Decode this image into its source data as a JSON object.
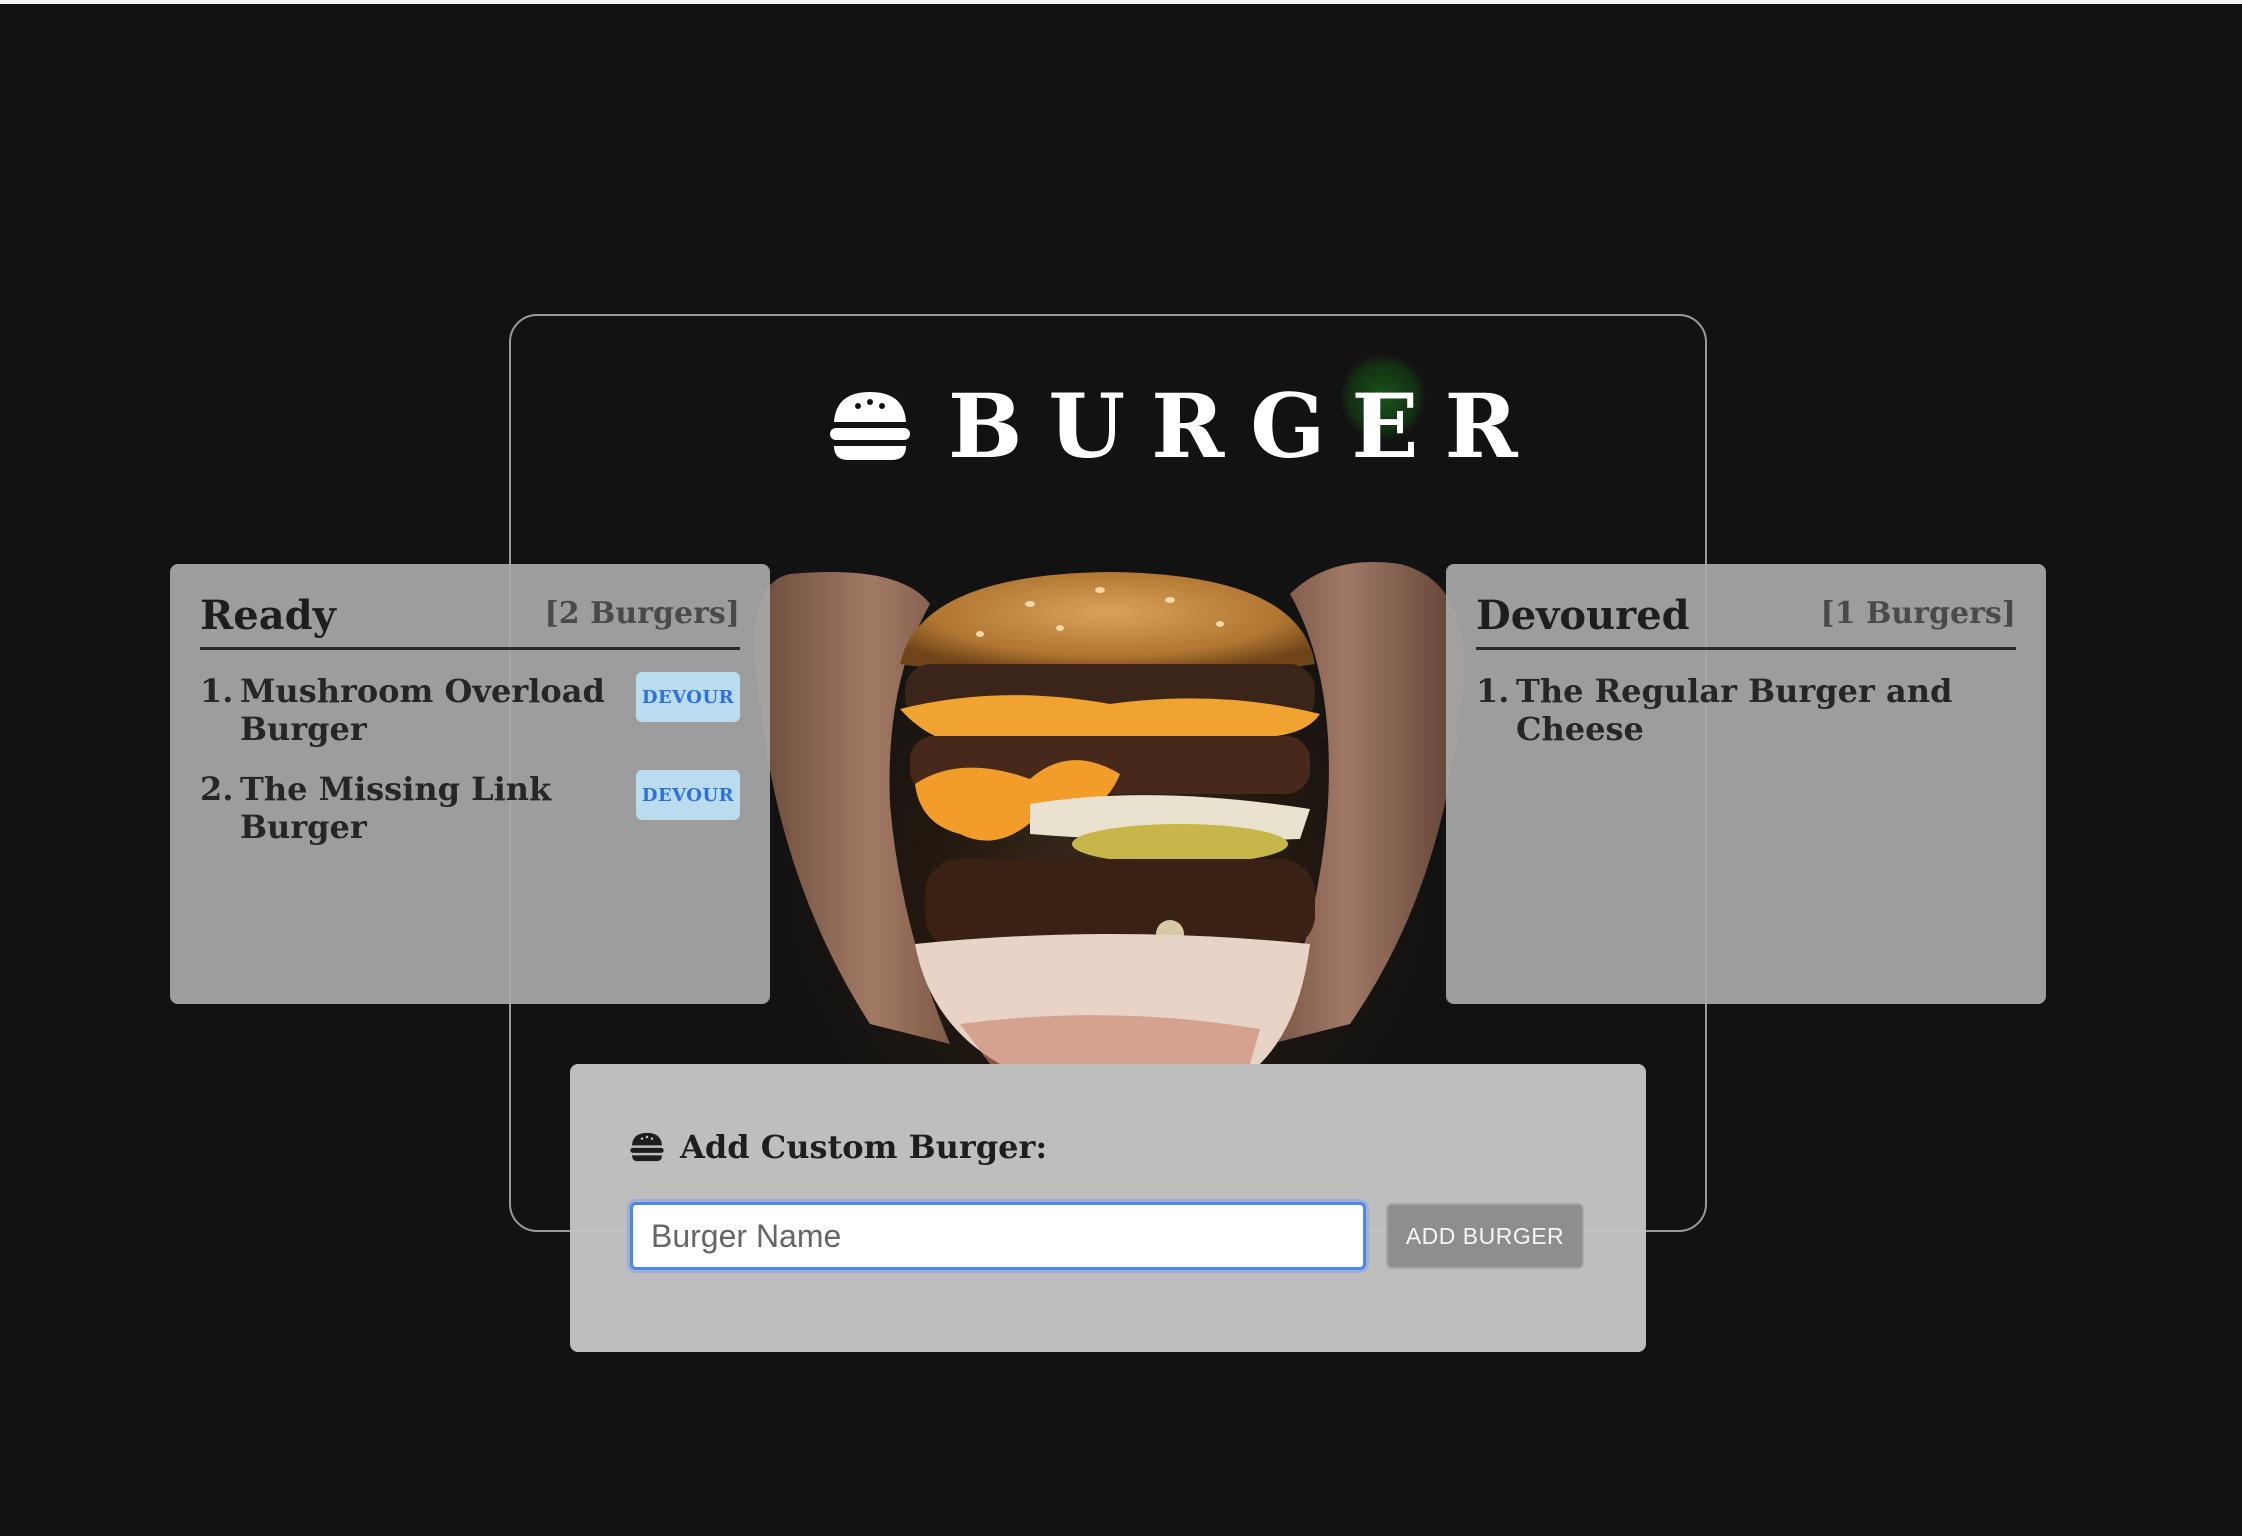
{
  "brand": {
    "title": "BURGER",
    "icon": "burger-icon"
  },
  "ready": {
    "title": "Ready",
    "count": "[2 Burgers]",
    "items": [
      {
        "number": "1.",
        "name": "Mushroom Overload Burger",
        "button": "DEVOUR"
      },
      {
        "number": "2.",
        "name": "The Missing Link Burger",
        "button": "DEVOUR"
      }
    ]
  },
  "devoured": {
    "title": "Devoured",
    "count": "[1 Burgers]",
    "items": [
      {
        "number": "1.",
        "name": "The Regular Burger and Cheese"
      }
    ]
  },
  "add_form": {
    "heading": "Add Custom Burger:",
    "icon": "burger-icon",
    "input_placeholder": "Burger Name",
    "input_value": "",
    "button_label": "ADD BURGER"
  },
  "colors": {
    "background": "#121212",
    "devour_button_bg": "#b9dcee",
    "devour_button_text": "#2f6fe0",
    "input_focus": "#4f86ec",
    "add_button_bg": "#8e8e8e"
  }
}
